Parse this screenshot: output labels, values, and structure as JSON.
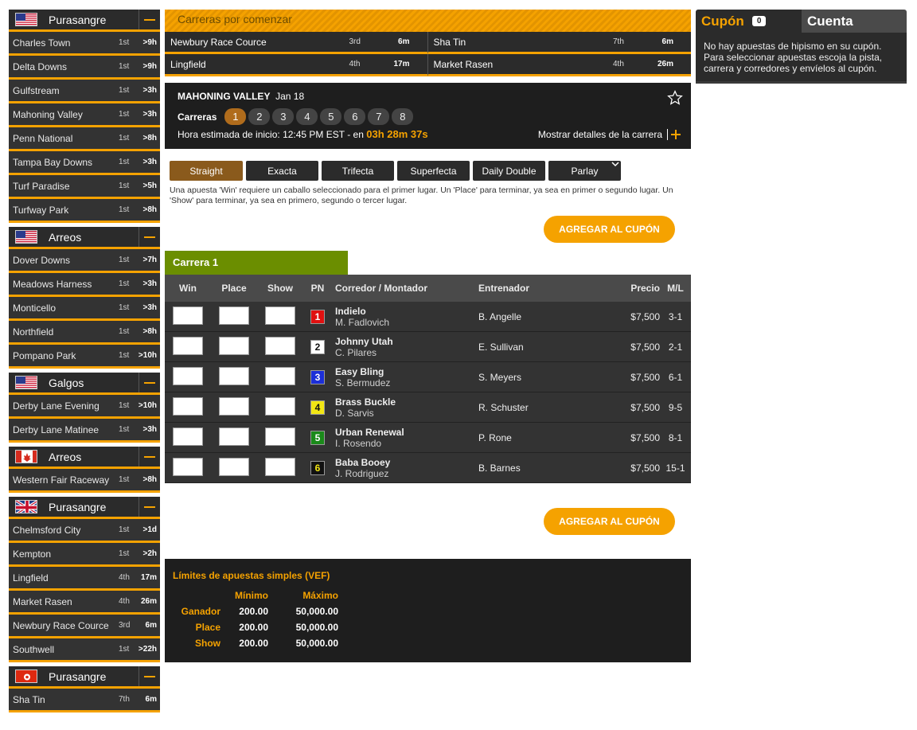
{
  "sidebar": {
    "groups": [
      {
        "title": "Purasangre",
        "flag": "us-flag-icon",
        "tracks": [
          {
            "name": "Charles Town",
            "race": "1st",
            "time": ">9h"
          },
          {
            "name": "Delta Downs",
            "race": "1st",
            "time": ">9h"
          },
          {
            "name": "Gulfstream",
            "race": "1st",
            "time": ">3h"
          },
          {
            "name": "Mahoning Valley",
            "race": "1st",
            "time": ">3h"
          },
          {
            "name": "Penn National",
            "race": "1st",
            "time": ">8h"
          },
          {
            "name": "Tampa Bay Downs",
            "race": "1st",
            "time": ">3h"
          },
          {
            "name": "Turf Paradise",
            "race": "1st",
            "time": ">5h"
          },
          {
            "name": "Turfway Park",
            "race": "1st",
            "time": ">8h"
          }
        ]
      },
      {
        "title": "Arreos",
        "flag": "us-flag-icon",
        "tracks": [
          {
            "name": "Dover Downs",
            "race": "1st",
            "time": ">7h"
          },
          {
            "name": "Meadows Harness",
            "race": "1st",
            "time": ">3h"
          },
          {
            "name": "Monticello",
            "race": "1st",
            "time": ">3h"
          },
          {
            "name": "Northfield",
            "race": "1st",
            "time": ">8h"
          },
          {
            "name": "Pompano Park",
            "race": "1st",
            "time": ">10h"
          }
        ]
      },
      {
        "title": "Galgos",
        "flag": "us-flag-icon",
        "tracks": [
          {
            "name": "Derby Lane Evening",
            "race": "1st",
            "time": ">10h"
          },
          {
            "name": "Derby Lane Matinee",
            "race": "1st",
            "time": ">3h"
          }
        ]
      },
      {
        "title": "Arreos",
        "flag": "canada-flag-icon",
        "tracks": [
          {
            "name": "Western Fair Raceway",
            "race": "1st",
            "time": ">8h"
          }
        ]
      },
      {
        "title": "Purasangre",
        "flag": "uk-flag-icon",
        "tracks": [
          {
            "name": "Chelmsford City",
            "race": "1st",
            "time": ">1d"
          },
          {
            "name": "Kempton",
            "race": "1st",
            "time": ">2h"
          },
          {
            "name": "Lingfield",
            "race": "4th",
            "time": "17m"
          },
          {
            "name": "Market Rasen",
            "race": "4th",
            "time": "26m"
          },
          {
            "name": "Newbury Race Cource",
            "race": "3rd",
            "time": "6m"
          },
          {
            "name": "Southwell",
            "race": "1st",
            "time": ">22h"
          }
        ]
      },
      {
        "title": "Purasangre",
        "flag": "hk-flag-icon",
        "tracks": [
          {
            "name": "Sha Tin",
            "race": "7th",
            "time": "6m"
          }
        ]
      }
    ]
  },
  "upcoming": {
    "header": "Carreras por comenzar",
    "items": [
      {
        "name": "Newbury Race Cource",
        "race": "3rd",
        "time": "6m"
      },
      {
        "name": "Sha Tin",
        "race": "7th",
        "time": "6m"
      },
      {
        "name": "Lingfield",
        "race": "4th",
        "time": "17m"
      },
      {
        "name": "Market Rasen",
        "race": "4th",
        "time": "26m"
      }
    ]
  },
  "race_header": {
    "track": "MAHONING VALLEY",
    "date": "Jan 18",
    "races_label": "Carreras",
    "races": [
      "1",
      "2",
      "3",
      "4",
      "5",
      "6",
      "7",
      "8"
    ],
    "active_race": "1",
    "start_label": "Hora estimada de inicio: 12:45 PM EST - en",
    "countdown": "03h 28m 37s",
    "details_label": "Mostrar detalles de la carrera"
  },
  "bet_types": [
    "Straight",
    "Exacta",
    "Trifecta",
    "Superfecta",
    "Daily Double",
    "Parlay"
  ],
  "active_bet_type": "Straight",
  "bet_description": "Una apuesta 'Win' requiere un caballo seleccionado para el primer lugar. Un 'Place' para terminar, ya sea en primer o segundo lugar. Un 'Show' para terminar, ya sea en primero, segundo o tercer lugar.",
  "add_button": "AGREGAR AL CUPÓN",
  "race_table": {
    "label": "Carrera 1",
    "headers": {
      "win": "Win",
      "place": "Place",
      "show": "Show",
      "pn": "PN",
      "runner": "Corredor / Montador",
      "trainer": "Entrenador",
      "price": "Precio",
      "ml": "M/L"
    },
    "rows": [
      {
        "pn": "1",
        "pn_bg": "#e01010",
        "pn_fg": "#ffffff",
        "horse": "Indielo",
        "jockey": "M. Fadlovich",
        "trainer": "B. Angelle",
        "price": "$7,500",
        "ml": "3-1"
      },
      {
        "pn": "2",
        "pn_bg": "#ffffff",
        "pn_fg": "#111111",
        "horse": "Johnny Utah",
        "jockey": "C. Pilares",
        "trainer": "E. Sullivan",
        "price": "$7,500",
        "ml": "2-1"
      },
      {
        "pn": "3",
        "pn_bg": "#1c2fd8",
        "pn_fg": "#ffffff",
        "horse": "Easy Bling",
        "jockey": "S. Bermudez",
        "trainer": "S. Meyers",
        "price": "$7,500",
        "ml": "6-1"
      },
      {
        "pn": "4",
        "pn_bg": "#f2e614",
        "pn_fg": "#111111",
        "horse": "Brass Buckle",
        "jockey": "D. Sarvis",
        "trainer": "R. Schuster",
        "price": "$7,500",
        "ml": "9-5"
      },
      {
        "pn": "5",
        "pn_bg": "#1a8a1a",
        "pn_fg": "#ffffff",
        "horse": "Urban Renewal",
        "jockey": "I. Rosendo",
        "trainer": "P. Rone",
        "price": "$7,500",
        "ml": "8-1"
      },
      {
        "pn": "6",
        "pn_bg": "#111111",
        "pn_fg": "#f2e614",
        "horse": "Baba Booey",
        "jockey": "J. Rodriguez",
        "trainer": "B. Barnes",
        "price": "$7,500",
        "ml": "15-1"
      }
    ]
  },
  "limits": {
    "title": "Límites de apuestas simples (VEF)",
    "min_label": "Mínimo",
    "max_label": "Máximo",
    "rows": [
      {
        "label": "Ganador",
        "min": "200.00",
        "max": "50,000.00"
      },
      {
        "label": "Place",
        "min": "200.00",
        "max": "50,000.00"
      },
      {
        "label": "Show",
        "min": "200.00",
        "max": "50,000.00"
      }
    ]
  },
  "coupon": {
    "tab_coupon": "Cupón",
    "count": "0",
    "tab_account": "Cuenta",
    "message": "No hay apuestas de hipismo en su cupón. Para seleccionar apuestas escoja la pista, carrera y corredores y envíelos al cupón."
  },
  "colors": {
    "accent": "#f5a200",
    "panel_dark": "#2b2b2b",
    "race_label": "#6b8e00",
    "active_race": "#b06c1c"
  }
}
